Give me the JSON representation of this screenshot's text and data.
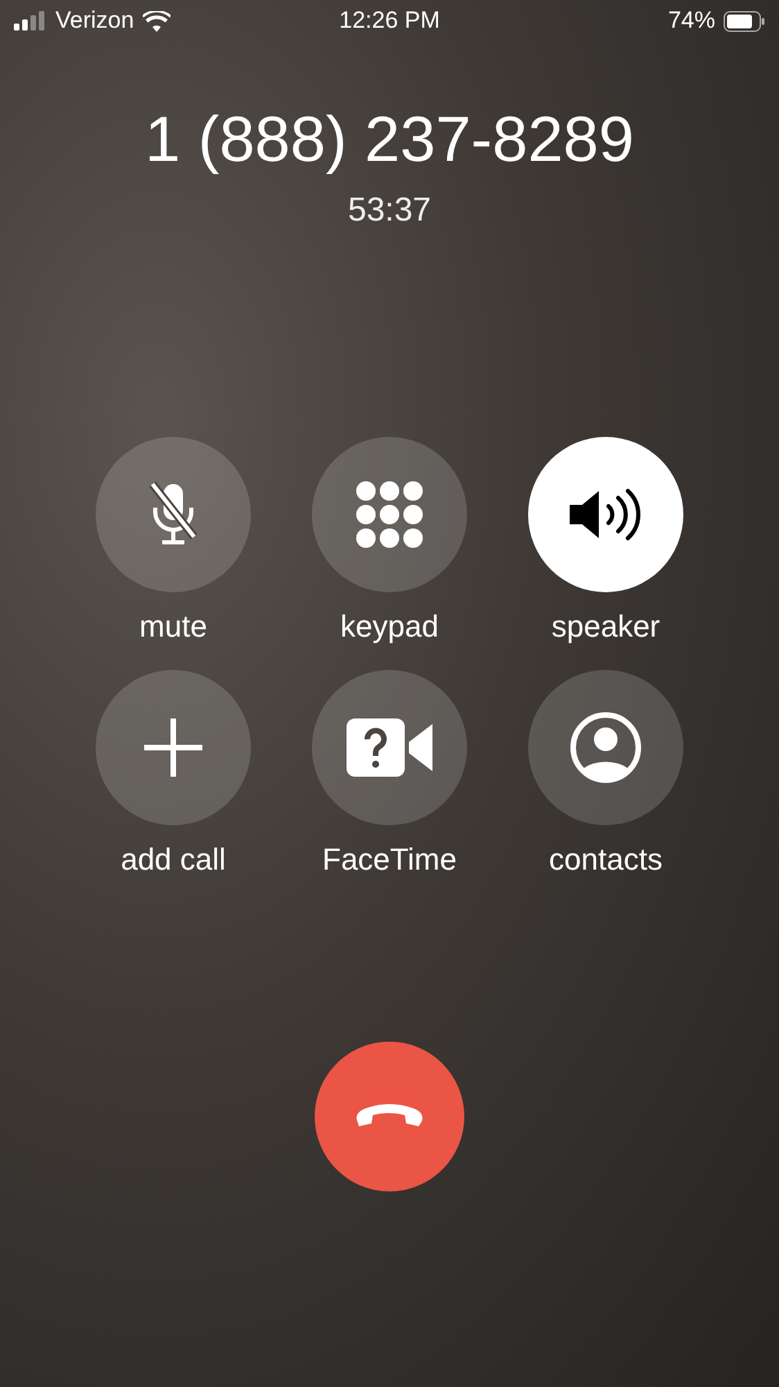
{
  "status_bar": {
    "carrier": "Verizon",
    "time": "12:26 PM",
    "battery": "74%"
  },
  "call": {
    "number": "1 (888) 237-8289",
    "duration": "53:37"
  },
  "buttons": [
    {
      "kind": "mute",
      "label": "mute",
      "on": false
    },
    {
      "kind": "keypad",
      "label": "keypad",
      "on": false
    },
    {
      "kind": "speaker",
      "label": "speaker",
      "on": true
    },
    {
      "kind": "add",
      "label": "add call",
      "on": false
    },
    {
      "kind": "facetime",
      "label": "FaceTime",
      "on": false
    },
    {
      "kind": "contacts",
      "label": "contacts",
      "on": false
    }
  ]
}
